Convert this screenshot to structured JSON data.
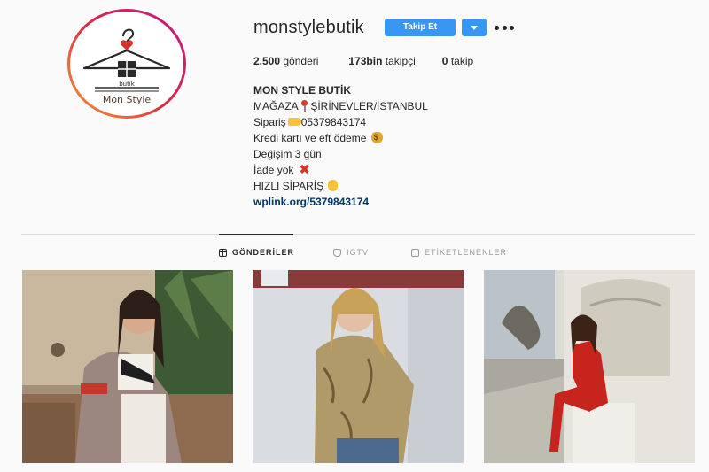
{
  "profile": {
    "username": "monstylebutik",
    "avatar_brand": "Mon Style",
    "avatar_small_text": "butik",
    "follow_label": "Takip Et",
    "stats": [
      {
        "value": "2.500",
        "label": "gönderi"
      },
      {
        "value": "173bin",
        "label": "takipçi"
      },
      {
        "value": "0",
        "label": "takip"
      }
    ]
  },
  "bio": {
    "name": "MON STYLE BUTİK",
    "lines": [
      "MAĞAZA ",
      "ŞİRİNEVLER/İSTANBUL",
      "Sipariş",
      "05379843174",
      "Kredi kartı ve eft ödeme ",
      "Değişim 3 gün",
      "İade yok ",
      "HIZLI SİPARİŞ "
    ],
    "link": "wplink.org/5379843174"
  },
  "tabs": [
    {
      "label": "GÖNDERİLER",
      "active": true
    },
    {
      "label": "IGTV",
      "active": false
    },
    {
      "label": "ETİKETLENENLER",
      "active": false
    }
  ],
  "colors": {
    "accent": "#3897f0",
    "link": "#003569",
    "divider": "#dbdbdb"
  },
  "icons": {
    "more": "more-options-icon",
    "dropdown": "chevron-down-icon",
    "posts_tab": "grid-icon",
    "igtv_tab": "tv-icon",
    "tagged_tab": "tag-person-icon"
  }
}
